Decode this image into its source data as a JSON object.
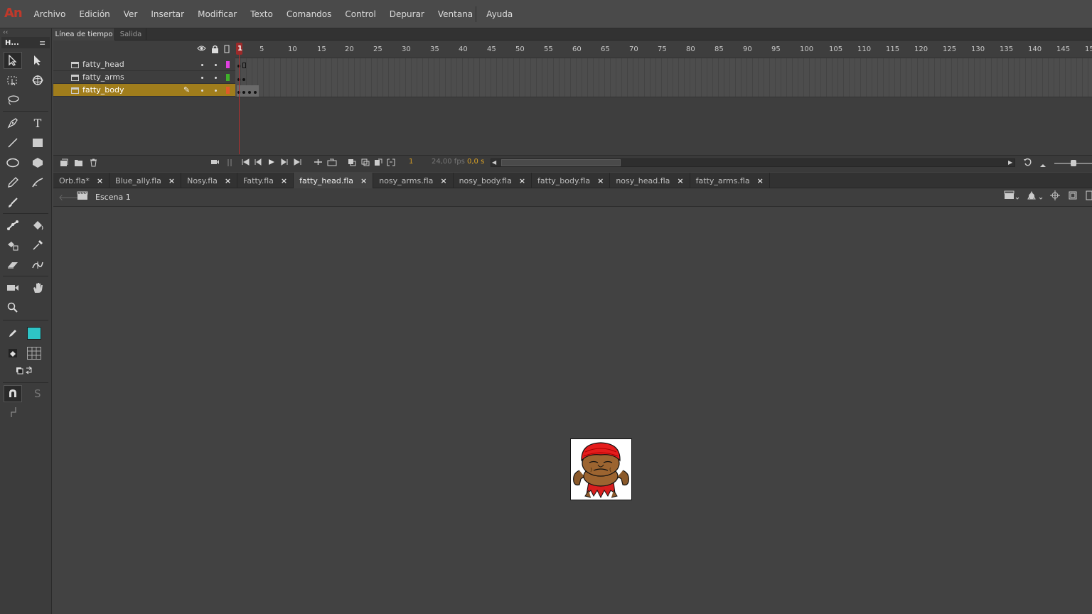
{
  "app": {
    "logo": "An"
  },
  "menu": [
    "Archivo",
    "Edición",
    "Ver",
    "Insertar",
    "Modificar",
    "Texto",
    "Comandos",
    "Control",
    "Depurar",
    "Ventana",
    "Ayuda"
  ],
  "toolbar": {
    "title": "H...",
    "tools": [
      "selection-tool",
      "subselection-tool",
      "free-transform-tool",
      "3d-rotation-tool",
      "lasso-tool",
      "pen-tool",
      "text-tool",
      "line-tool",
      "rectangle-tool",
      "oval-tool",
      "polystar-tool",
      "pencil-tool",
      "paint-brush-tool",
      "brush-tool",
      "bone-tool",
      "paint-bucket-tool",
      "ink-bottle-tool",
      "eyedropper-tool",
      "eraser-tool",
      "width-tool",
      "camera-tool",
      "hand-tool",
      "zoom-tool"
    ],
    "stroke_color": "#3a3a3a",
    "fill_color": "#2ec4c6",
    "snap_label": "S"
  },
  "timeline": {
    "tabs": [
      "Línea de tiempo",
      "Salida"
    ],
    "layers": [
      {
        "name": "fatty_head",
        "color": "#e040e0",
        "active": false
      },
      {
        "name": "fatty_arms",
        "color": "#3fb02a",
        "active": false
      },
      {
        "name": "fatty_body",
        "color": "#e05a2a",
        "active": true
      }
    ],
    "ruler": [
      "5",
      "10",
      "15",
      "20",
      "25",
      "30",
      "35",
      "40",
      "45",
      "50",
      "55",
      "60",
      "65",
      "70",
      "75",
      "80",
      "85",
      "90",
      "95",
      "100",
      "105",
      "110",
      "115",
      "120",
      "125",
      "130",
      "135",
      "140",
      "145",
      "15"
    ],
    "current_frame": "1",
    "frame_display": "1",
    "fps": "24,00 fps",
    "seconds": "0,0 s"
  },
  "doc_tabs": [
    {
      "label": "Orb.fla*",
      "active": false
    },
    {
      "label": "Blue_ally.fla",
      "active": false
    },
    {
      "label": "Nosy.fla",
      "active": false
    },
    {
      "label": "Fatty.fla",
      "active": false
    },
    {
      "label": "fatty_head.fla",
      "active": true
    },
    {
      "label": "nosy_arms.fla",
      "active": false
    },
    {
      "label": "nosy_body.fla",
      "active": false
    },
    {
      "label": "fatty_body.fla",
      "active": false
    },
    {
      "label": "nosy_head.fla",
      "active": false
    },
    {
      "label": "fatty_arms.fla",
      "active": false
    }
  ],
  "scene": {
    "label": "Escena 1"
  },
  "stage": {
    "background": "#ffffff"
  }
}
